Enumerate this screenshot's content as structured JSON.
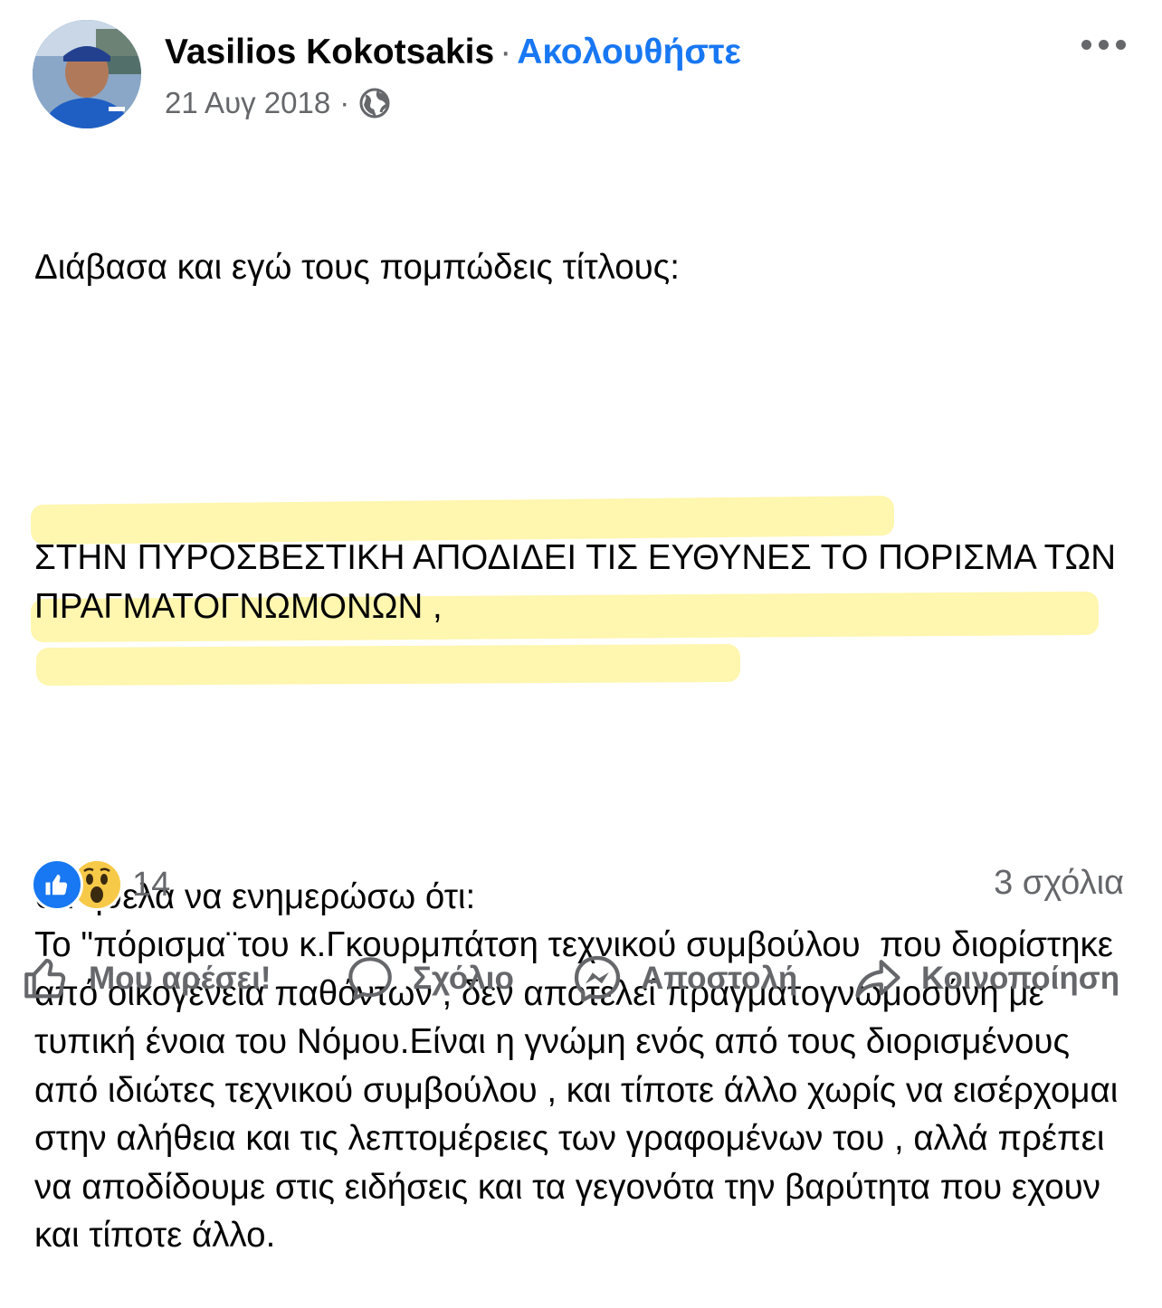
{
  "post": {
    "author": "Vasilios Kokotsakis",
    "separator": "·",
    "follow_label": "Ακολουθήστε",
    "date": "21 Αυγ 2018",
    "date_separator": "·",
    "privacy_icon": "globe-icon",
    "more_icon": "more-options-icon",
    "paragraphs": [
      "Διάβασα και εγώ τους πομπώδεις τίτλους:",
      "",
      "ΣΤΗΝ ΠΥΡΟΣΒΕΣΤΙΚΗ ΑΠΟΔΙΔΕΙ ΤΙΣ ΕΥΘΥΝΕΣ ΤΟ ΠΟΡΙΣΜΑ ΤΩΝ ΠΡΑΓΜΑΤΟΓΝΩΜΟΝΩΝ ,",
      "",
      "θα ήθελα να ενημερώσω ότι:\nΤο \"πόρισμα¨του κ.Γκουρμπάτση τεχνικού συμβούλου  που διορίστηκε από οικογένεια παθόντων , δεν αποτελεί πραγματογνωμοσύνη με τυπική ένοια του Νόμου.Είναι η γνώμη ενός από τους διορισμένους από ιδιώτες τεχνικού συμβούλου , και τίποτε άλλο χωρίς να εισέρχομαι στην αλήθεια και τις λεπτομέρειες των γραφομένων του , αλλά πρέπει να αποδίδουμε στις ειδήσεις και τα γεγονότα την βαρύτητα που εχουν και τίποτε άλλο."
    ],
    "highlight_color": "#fff06e"
  },
  "stats": {
    "reaction_icons": [
      "like-icon",
      "wow-icon"
    ],
    "reaction_count": "14",
    "comments": "3 σχόλια"
  },
  "actions": [
    {
      "icon": "thumbs-up-icon",
      "label": "Μου αρέσει!"
    },
    {
      "icon": "comment-icon",
      "label": "Σχόλιο"
    },
    {
      "icon": "messenger-icon",
      "label": "Αποστολή"
    },
    {
      "icon": "share-icon",
      "label": "Κοινοποίηση"
    }
  ],
  "colors": {
    "accent": "#1877f2",
    "secondary_text": "#65676b",
    "text": "#050505"
  }
}
